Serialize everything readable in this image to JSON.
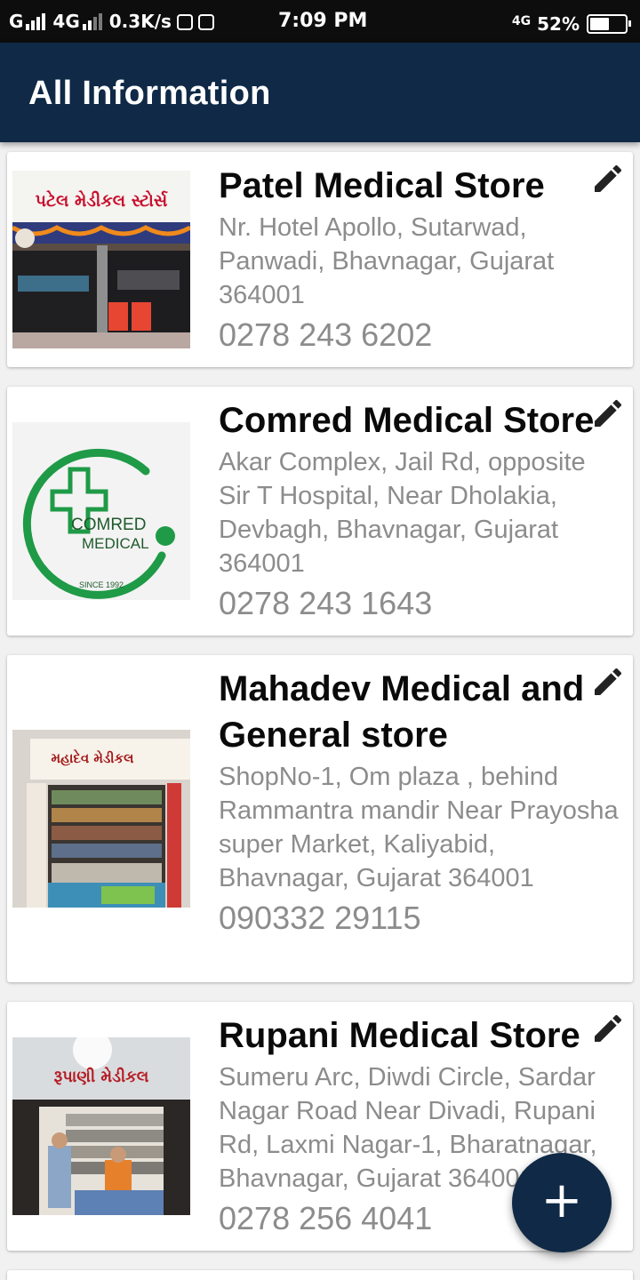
{
  "status_bar": {
    "network_1": "G",
    "network_2": "4G",
    "speed": "0.3K/s",
    "time": "7:09 PM",
    "volte": "4G",
    "battery": "52%"
  },
  "app_bar": {
    "title": "All Information"
  },
  "stores": [
    {
      "name": "Patel Medical Store",
      "address": "Nr. Hotel Apollo, Sutarwad, Panwadi, Bhavnagar, Gujarat 364001",
      "phone": "0278 243 6202",
      "sign_text": "પટેલ મેડીકલ સ્ટોર્સ"
    },
    {
      "name": "Comred Medical Store",
      "address": "Akar Complex, Jail Rd, opposite Sir T Hospital, Near Dholakia, Devbagh, Bhavnagar, Gujarat 364001",
      "phone": "0278 243 1643",
      "logo_line1": "COMRED",
      "logo_line2": "MEDICAL",
      "logo_since": "SINCE 1992"
    },
    {
      "name": "Mahadev Medical and General store",
      "address": "ShopNo-1, Om plaza , behind Rammantra mandir Near Prayosha super Market, Kaliyabid, Bhavnagar, Gujarat 364001",
      "phone": "090332 29115",
      "sign_text": "મહાદેવ મેડીકલ"
    },
    {
      "name": "Rupani Medical Store",
      "address": "Sumeru Arc, Diwdi Circle, Sardar Nagar Road Near Divadi, Rupani Rd, Laxmi Nagar-1, Bharatnagar, Bhavnagar, Gujarat 364001",
      "phone": "0278 256 4041",
      "sign_text": "રૂપાણી મેડીકલ"
    }
  ],
  "fab": {
    "icon": "plus-icon",
    "label": "+"
  },
  "colors": {
    "primary": "#0f2946",
    "status_bar": "#0d0d0d",
    "secondary_text": "#8c8c8c"
  }
}
